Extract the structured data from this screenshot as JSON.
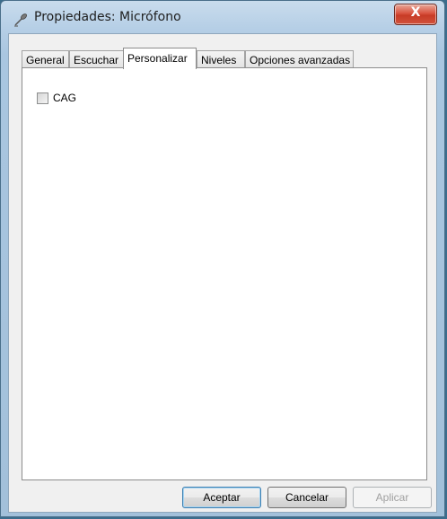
{
  "window": {
    "title": "Propiedades: Micrófono",
    "close_label": "X",
    "icon": "microphone-icon"
  },
  "tabs": [
    {
      "label": "General",
      "active": false
    },
    {
      "label": "Escuchar",
      "active": false
    },
    {
      "label": "Personalizar",
      "active": true
    },
    {
      "label": "Niveles",
      "active": false
    },
    {
      "label": "Opciones avanzadas",
      "active": false
    }
  ],
  "panel": {
    "agc_checkbox_label": "CAG",
    "agc_checked": false
  },
  "buttons": {
    "ok": "Aceptar",
    "cancel": "Cancelar",
    "apply": "Aplicar"
  }
}
